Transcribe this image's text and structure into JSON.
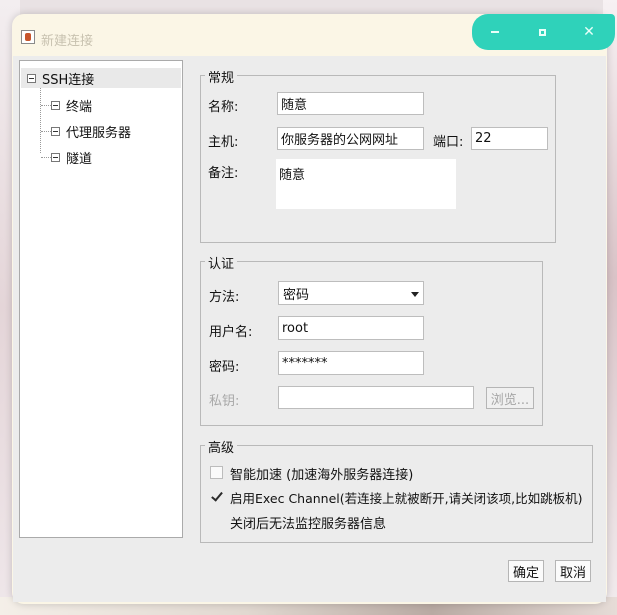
{
  "window": {
    "title": "新建连接"
  },
  "tree": {
    "root": "SSH连接",
    "children": [
      "终端",
      "代理服务器",
      "隧道"
    ]
  },
  "general": {
    "legend": "常规",
    "name_label": "名称:",
    "name_value": "随意",
    "host_label": "主机:",
    "host_value": "你服务器的公网网址",
    "port_label": "端口:",
    "port_value": "22",
    "note_label": "备注:",
    "note_value": "随意"
  },
  "auth": {
    "legend": "认证",
    "method_label": "方法:",
    "method_value": "密码",
    "user_label": "用户名:",
    "user_value": "root",
    "password_label": "密码:",
    "password_value": "*******",
    "key_label": "私钥:",
    "key_value": "",
    "browse_label": "浏览..."
  },
  "advanced": {
    "legend": "高级",
    "smart_accel_label": "智能加速 (加速海外服务器连接)",
    "smart_accel_checked": false,
    "exec_channel_label": "启用Exec Channel(若连接上就被断开,请关闭该项,比如跳板机)",
    "exec_channel_checked": true,
    "exec_channel_note": "关闭后无法监控服务器信息"
  },
  "footer": {
    "ok_label": "确定",
    "cancel_label": "取消"
  },
  "colors": {
    "window_controls": "#2fd2ba",
    "titlebar": "#fbf6e6",
    "panel": "#ececec"
  }
}
